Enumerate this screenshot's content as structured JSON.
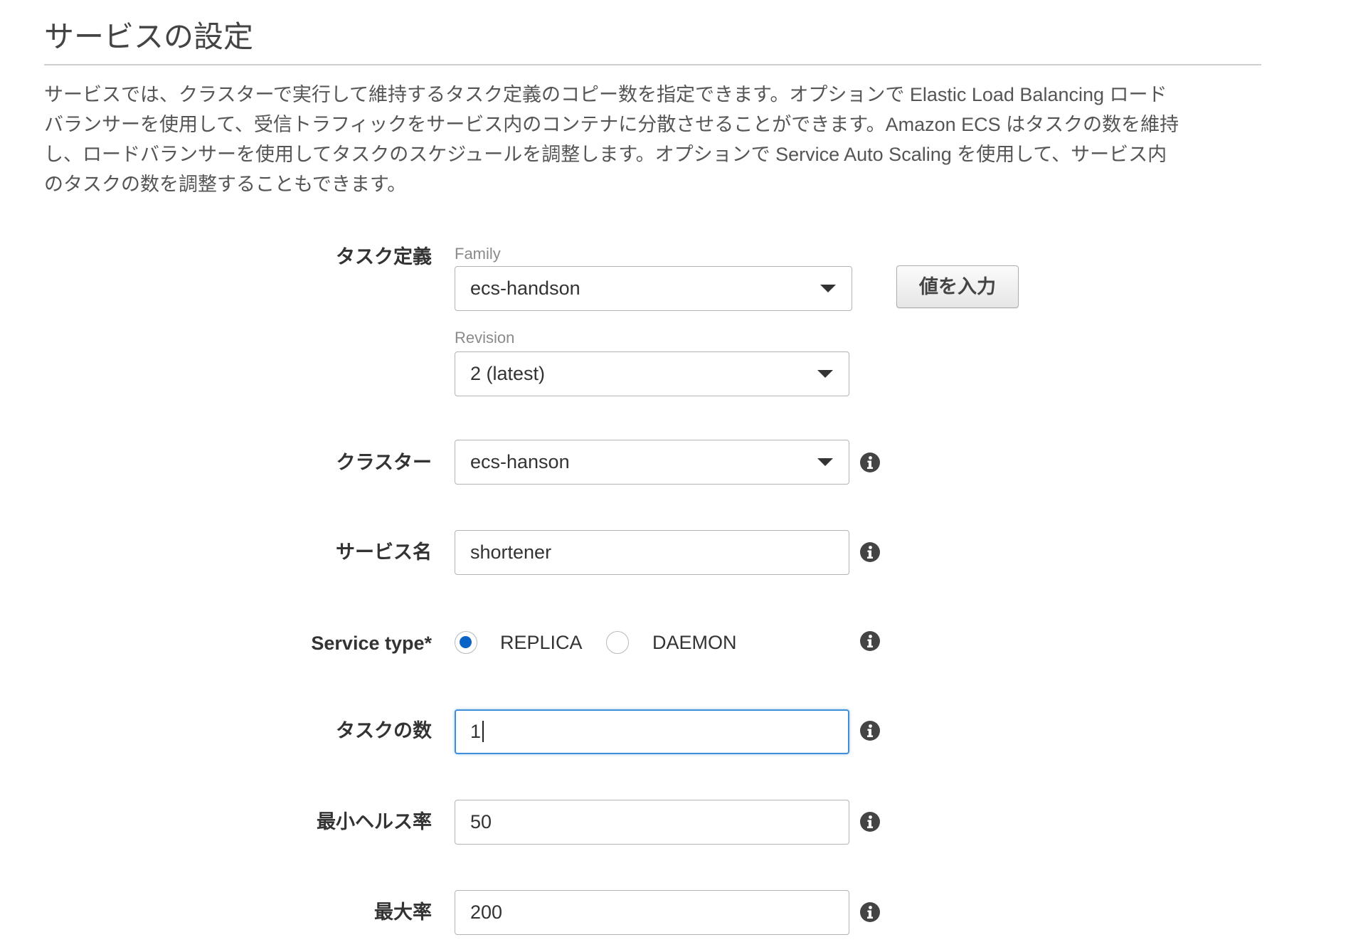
{
  "page": {
    "title": "サービスの設定",
    "description_lines": [
      "サービスでは、クラスターで実行して維持するタスク定義のコピー数を指定できます。オプションで Elastic Load Balancing ロード",
      "バランサーを使用して、受信トラフィックをサービス内のコンテナに分散させることができます。Amazon ECS はタスクの数を維持",
      "し、ロードバランサーを使用してタスクのスケジュールを調整します。オプションで Service Auto Scaling を使用して、サービス内",
      "のタスクの数を調整することもできます。"
    ]
  },
  "form": {
    "task_definition": {
      "label": "タスク定義",
      "family_label": "Family",
      "family_value": "ecs-handson",
      "revision_label": "Revision",
      "revision_value": "2 (latest)",
      "enter_value_button": "値を入力"
    },
    "cluster": {
      "label": "クラスター",
      "value": "ecs-hanson"
    },
    "service_name": {
      "label": "サービス名",
      "value": "shortener"
    },
    "service_type": {
      "label": "Service type*",
      "options": [
        {
          "label": "REPLICA",
          "selected": true
        },
        {
          "label": "DAEMON",
          "selected": false
        }
      ]
    },
    "task_count": {
      "label": "タスクの数",
      "value": "1",
      "focused": true
    },
    "min_healthy_percent": {
      "label": "最小ヘルス率",
      "value": "50"
    },
    "max_percent": {
      "label": "最大率",
      "value": "200"
    }
  },
  "icons": {
    "select_caret": "caret-down-icon",
    "info": "info-icon"
  },
  "colors": {
    "focus_border": "#3f8fd8",
    "radio_selected": "#0c63c6",
    "info_icon": "#444444"
  }
}
